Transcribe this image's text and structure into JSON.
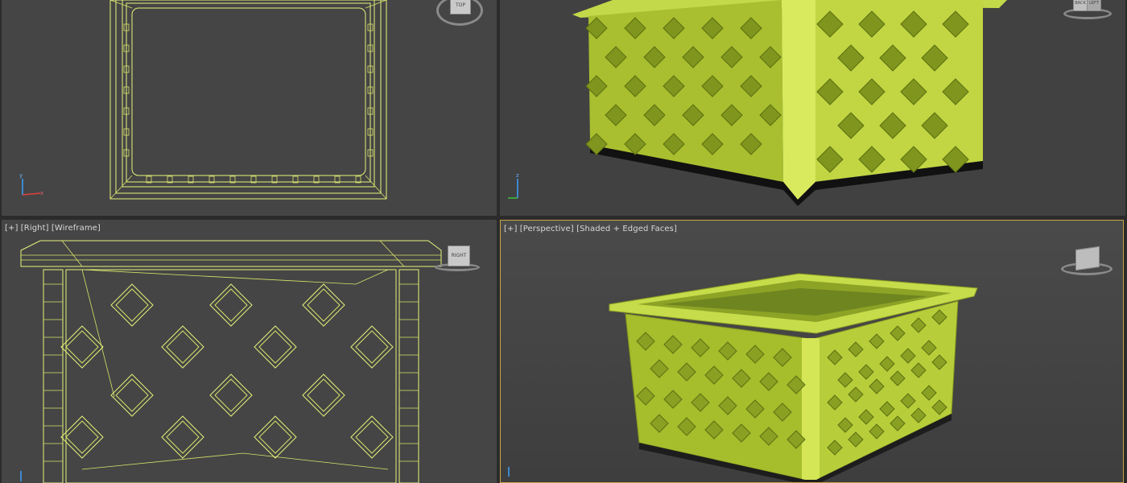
{
  "viewports": {
    "right": {
      "plus": "[+]",
      "view": "[Right]",
      "mode": "[Wireframe]"
    },
    "perspective": {
      "plus": "[+]",
      "view": "[Perspective]",
      "mode": "[Shaded + Edged Faces]"
    }
  },
  "viewcube": {
    "top_label": "TOP",
    "right_label": "RIGHT",
    "persp_label_a": "BACK",
    "persp_label_b": "LEFT"
  },
  "colors": {
    "wireframe": "#e6f27a",
    "shaded": "#b6cc36",
    "viewport_bg": "#454545",
    "active_border": "#c8a44a"
  },
  "axis": {
    "x": "x",
    "y": "y",
    "z": "z"
  }
}
